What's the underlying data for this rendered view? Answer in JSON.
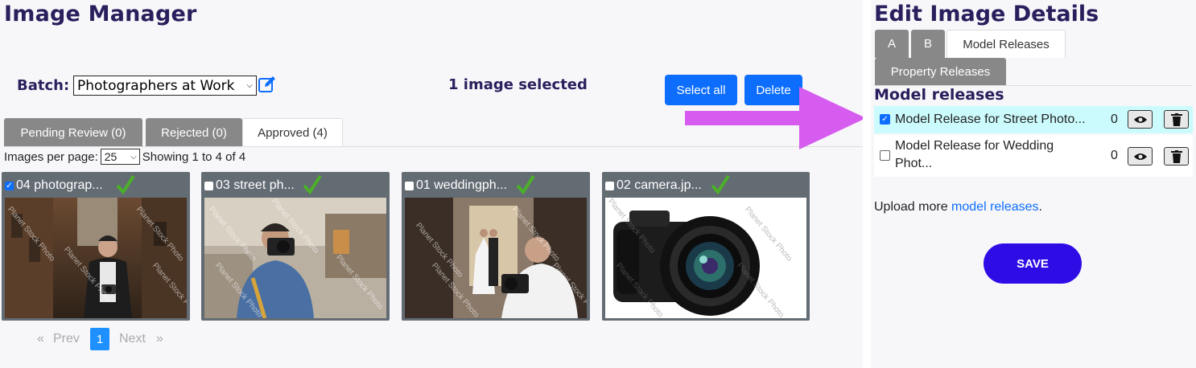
{
  "left": {
    "title": "Image Manager",
    "batch_label": "Batch:",
    "batch_value": "Photographers at Work",
    "selected_status": "1 image selected",
    "select_all_label": "Select all",
    "delete_label": "Delete",
    "tabs": [
      {
        "label": "Pending Review (0)",
        "active": false
      },
      {
        "label": "Rejected (0)",
        "active": false
      },
      {
        "label": "Approved (4)",
        "active": true
      }
    ],
    "per_page_label": "Images per page:",
    "per_page_value": "25",
    "showing_text": "Showing 1 to 4 of 4",
    "cards": [
      {
        "name": "04 photograp...",
        "checked": true
      },
      {
        "name": "03 street ph...",
        "checked": false
      },
      {
        "name": "01 weddingph...",
        "checked": false
      },
      {
        "name": "02 camera.jp...",
        "checked": false
      }
    ],
    "watermark": "Planet Stock Photo",
    "pager": {
      "first": "«",
      "prev": "Prev",
      "current": "1",
      "next": "Next",
      "last": "»"
    }
  },
  "right": {
    "title": "Edit Image Details",
    "tabs": [
      {
        "label": "A",
        "active": false
      },
      {
        "label": "B",
        "active": false
      },
      {
        "label": "Model Releases",
        "active": true
      },
      {
        "label": "Property Releases",
        "active": false
      }
    ],
    "section_title": "Model releases",
    "releases": [
      {
        "name": "Model Release for Street Photo...",
        "count": "0",
        "checked": true
      },
      {
        "name_line1": "Model Release for Wedding",
        "name_line2": "Phot...",
        "count": "0",
        "checked": false
      }
    ],
    "upload_prefix": "Upload more ",
    "upload_link": "model releases",
    "upload_suffix": ".",
    "save_label": "SAVE"
  },
  "colors": {
    "accent": "#0d6efd",
    "title": "#2a1e5c",
    "save": "#2d0ce6",
    "highlight_row": "#ccfbfd",
    "arrow": "#d65cf0",
    "check_green": "#4caf2a"
  }
}
